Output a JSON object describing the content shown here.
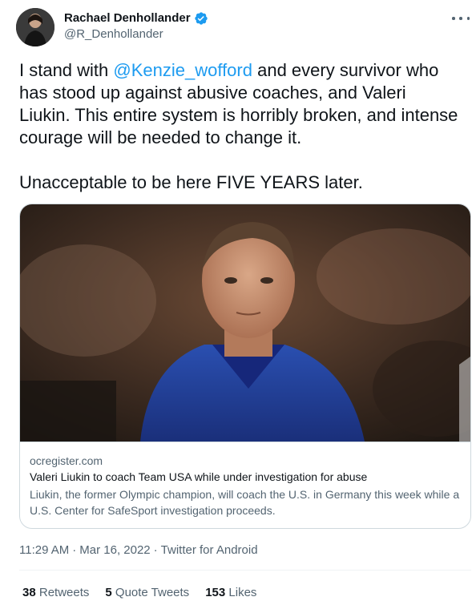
{
  "author": {
    "display_name": "Rachael Denhollander",
    "handle": "@R_Denhollander",
    "verified_icon": "verified-badge-icon",
    "avatar_icon": "profile-photo"
  },
  "tweet": {
    "text_before": "I stand with ",
    "mention": "@Kenzie_wofford",
    "text_after": " and every survivor who has stood up against abusive coaches, and Valeri Liukin. This entire system is horribly broken, and intense courage will be needed to change it.\n\nUnacceptable to be here FIVE YEARS later."
  },
  "card": {
    "domain": "ocregister.com",
    "title": "Valeri Liukin to coach Team USA while under investigation for abuse",
    "description": "Liukin, the former Olympic champion, will coach the U.S. in Germany this week while a U.S. Center for SafeSport investigation proceeds."
  },
  "meta": {
    "time": "11:29 AM",
    "separator": "·",
    "date": "Mar 16, 2022",
    "source": "Twitter for Android"
  },
  "stats": {
    "retweets_count": "38",
    "retweets_label": "Retweets",
    "quotes_count": "5",
    "quotes_label": "Quote Tweets",
    "likes_count": "153",
    "likes_label": "Likes"
  },
  "colors": {
    "accent": "#1d9bf0",
    "secondary_text": "#536471",
    "border": "#cfd9de"
  }
}
